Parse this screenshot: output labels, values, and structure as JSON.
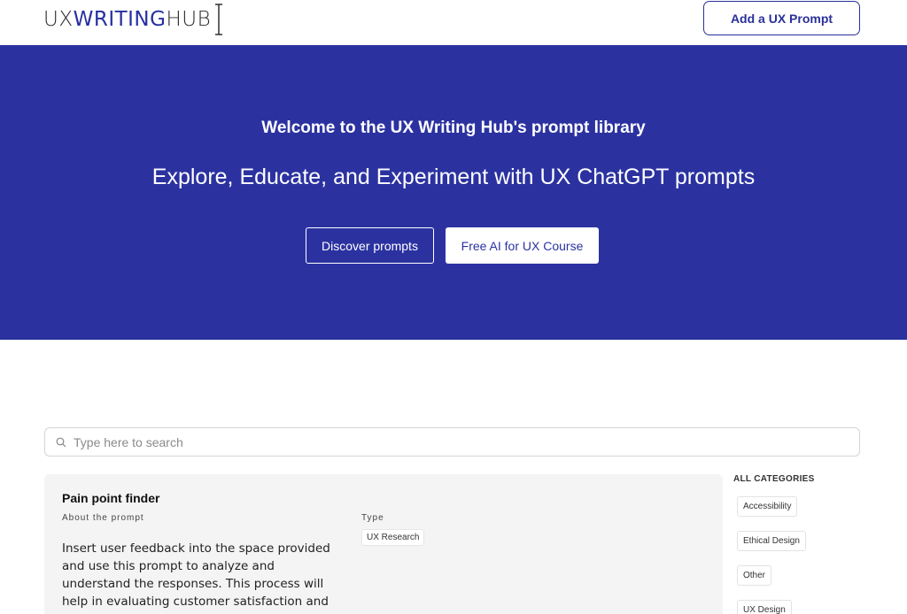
{
  "header": {
    "logo_ux": "UX",
    "logo_writing": "WRITING",
    "logo_hub": "HUB",
    "add_button": "Add a UX Prompt"
  },
  "hero": {
    "title": "Welcome to the UX Writing Hub's prompt library",
    "subtitle": "Explore, Educate, and Experiment with UX ChatGPT prompts",
    "btn_discover": "Discover prompts",
    "btn_course": "Free AI for UX Course"
  },
  "search": {
    "placeholder": "Type here to search",
    "icon": "search-icon"
  },
  "card": {
    "title": "Pain point finder",
    "about_label": "About the prompt",
    "type_label": "Type",
    "type_value": "UX Research",
    "description": "Insert user feedback into the space provided and use this prompt to analyze and understand the responses. This process will help in evaluating customer satisfaction and identifying areas for"
  },
  "sidebar": {
    "title": "ALL CATEGORIES",
    "categories": [
      "Accessibility",
      "Ethical Design",
      "Other",
      "UX Design"
    ]
  },
  "colors": {
    "brand": "#2b32a0",
    "card_bg": "#f4f4f4"
  }
}
